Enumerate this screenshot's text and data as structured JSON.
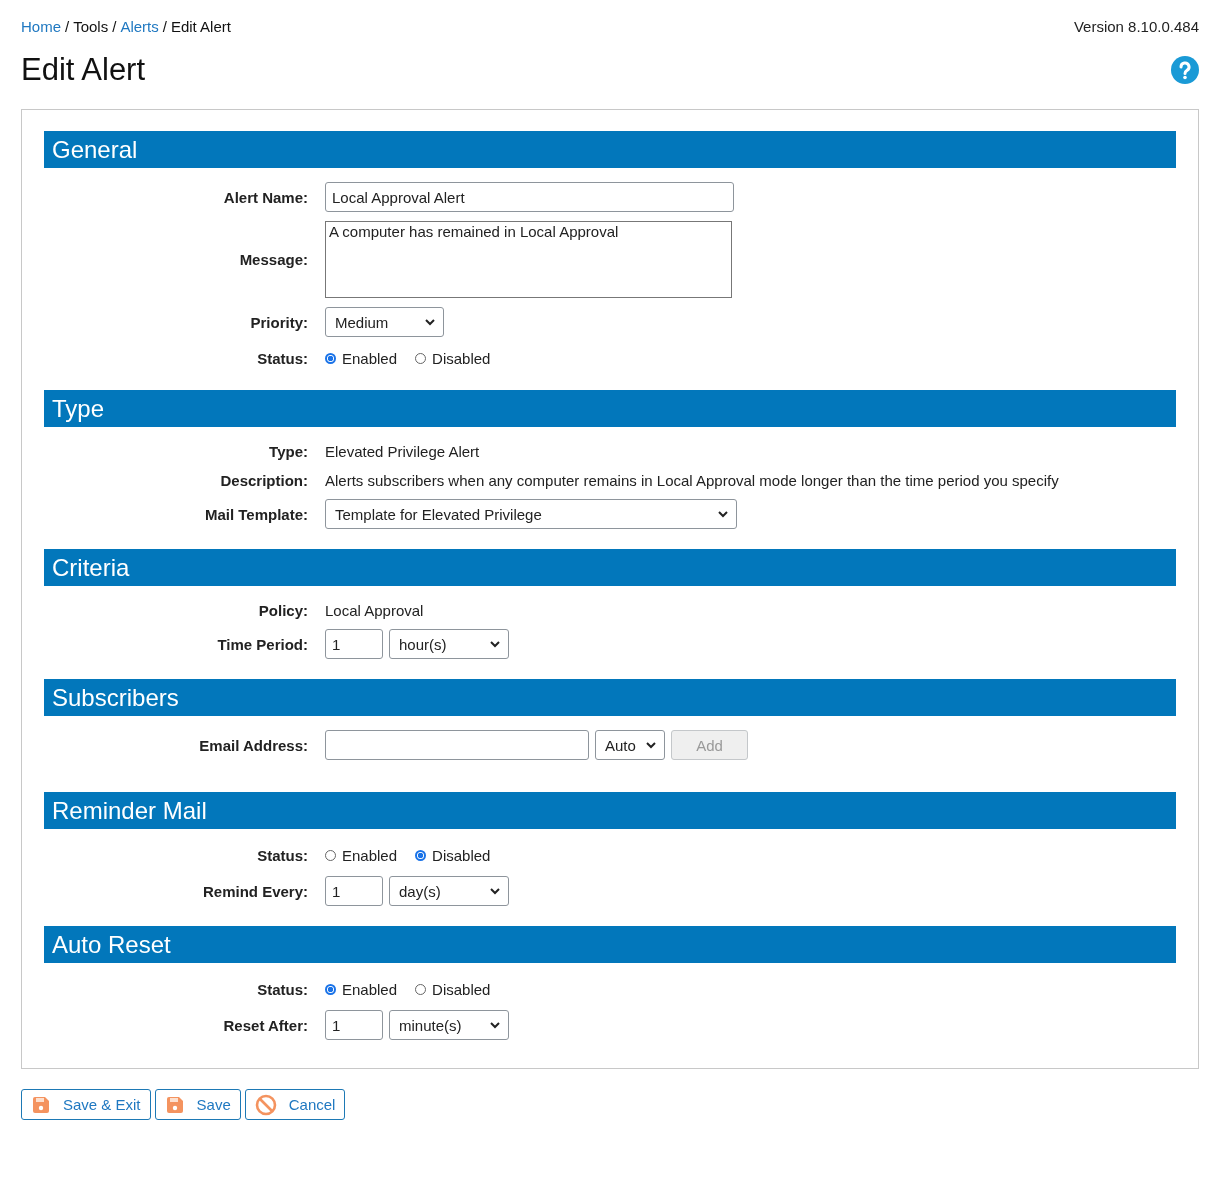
{
  "breadcrumb": [
    {
      "label": "Home",
      "link": true
    },
    {
      "label": "Tools",
      "link": false
    },
    {
      "label": "Alerts",
      "link": true
    },
    {
      "label": "Edit Alert",
      "link": false
    }
  ],
  "separator": "/",
  "version": "Version 8.10.0.484",
  "title": "Edit Alert",
  "sections": [
    {
      "title": "General",
      "rows": [
        {
          "kind": "input",
          "label": "Alert Name:",
          "value": "Local Approval Alert"
        },
        {
          "kind": "textarea",
          "label": "Message:",
          "value": "A computer has remained in Local Approval"
        },
        {
          "kind": "select",
          "label": "Priority:",
          "value": "Medium"
        },
        {
          "kind": "radio",
          "label": "Status:",
          "options": [
            {
              "label": "Enabled",
              "selected": true
            },
            {
              "label": "Disabled",
              "selected": false
            }
          ]
        }
      ]
    },
    {
      "title": "Type",
      "rows": [
        {
          "kind": "static",
          "label": "Type:",
          "value": "Elevated Privilege Alert"
        },
        {
          "kind": "static",
          "label": "Description:",
          "value": "Alerts subscribers when any computer remains in Local Approval mode longer than the time period you specify"
        },
        {
          "kind": "template",
          "label": "Mail Template:",
          "value": "Template for Elevated Privilege"
        }
      ]
    },
    {
      "title": "Criteria",
      "rows": [
        {
          "kind": "static",
          "label": "Policy:",
          "value": "Local Approval"
        },
        {
          "kind": "period",
          "label": "Time Period:",
          "value": "1",
          "unit": "hour(s)"
        }
      ]
    },
    {
      "title": "Subscribers",
      "rows": [
        {
          "kind": "email",
          "label": "Email Address:",
          "value": "",
          "unit": "Auto",
          "button": {
            "label": "Add",
            "disabled": true
          }
        }
      ]
    },
    {
      "title": "Reminder Mail",
      "rows": [
        {
          "kind": "radio",
          "label": "Status:",
          "options": [
            {
              "label": "Enabled",
              "selected": false
            },
            {
              "label": "Disabled",
              "selected": true
            }
          ]
        },
        {
          "kind": "period",
          "label": "Remind Every:",
          "value": "1",
          "unit": "day(s)"
        }
      ]
    },
    {
      "title": "Auto Reset",
      "rows": [
        {
          "kind": "radio",
          "label": "Status:",
          "options": [
            {
              "label": "Enabled",
              "selected": true
            },
            {
              "label": "Disabled",
              "selected": false
            }
          ]
        },
        {
          "kind": "period",
          "label": "Reset After:",
          "value": "1",
          "unit": "minute(s)"
        }
      ]
    }
  ],
  "actions": [
    {
      "label": "Save & Exit",
      "kind": "save"
    },
    {
      "label": "Save",
      "kind": "save"
    },
    {
      "label": "Cancel",
      "kind": "cancel"
    }
  ]
}
